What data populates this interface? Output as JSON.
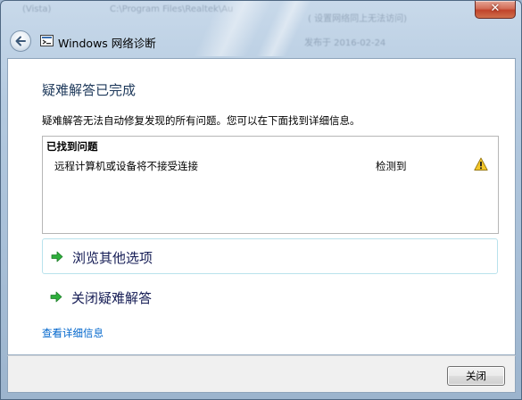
{
  "window": {
    "title": "Windows 网络诊断",
    "close_glyph": "✕",
    "background_text": [
      "(Vista)",
      "C:\\Program Files\\Realtek\\Au",
      "( 设置网络同上无法访问)",
      "发布于 2016-02-24"
    ]
  },
  "content": {
    "heading": "疑难解答已完成",
    "description": "疑难解答无法自动修复发现的所有问题。您可以在下面找到详细信息。",
    "problems": {
      "header": "已找到问题",
      "items": [
        {
          "name": "远程计算机或设备将不接受连接",
          "status": "检测到",
          "icon": "warning-icon"
        }
      ]
    },
    "options": [
      {
        "label": "浏览其他选项",
        "icon": "green-arrow-icon"
      },
      {
        "label": "关闭疑难解答",
        "icon": "green-arrow-icon"
      }
    ],
    "details_link": "查看详细信息"
  },
  "footer": {
    "close_button": "关闭"
  },
  "colors": {
    "heading": "#1e395b",
    "link": "#0066cc",
    "option_text": "#151c55",
    "arrow_green": "#2eae3c",
    "warning_yellow": "#f4c72a"
  }
}
